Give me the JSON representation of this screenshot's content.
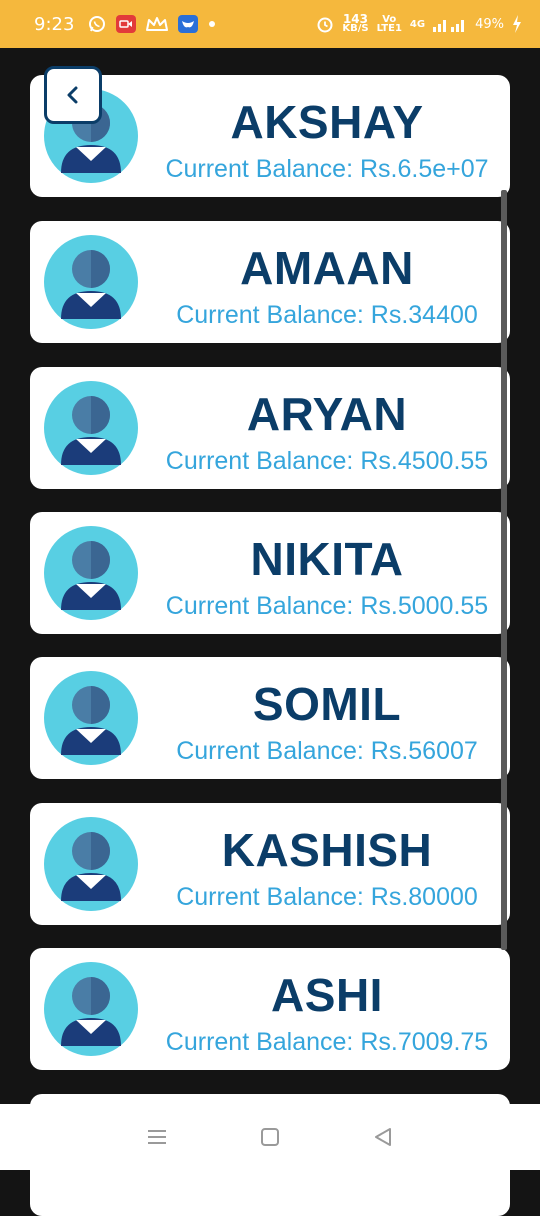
{
  "status_bar": {
    "time": "9:23",
    "net_speed_value": "143",
    "net_speed_unit": "KB/S",
    "volte_top": "Vo",
    "volte_bottom": "LTE1",
    "network_type": "4G",
    "battery": "49%",
    "icons": [
      "whatsapp-icon",
      "video-record-icon",
      "crown-icon",
      "bluesky-icon",
      "dot-icon",
      "alarm-icon",
      "signal-icon",
      "battery-charging-icon"
    ]
  },
  "customers": [
    {
      "name": "AKSHAY",
      "balance": "Current Balance: Rs.6.5e+07"
    },
    {
      "name": "AMAAN",
      "balance": "Current Balance: Rs.34400"
    },
    {
      "name": "ARYAN",
      "balance": "Current Balance: Rs.4500.55"
    },
    {
      "name": "NIKITA",
      "balance": "Current Balance: Rs.5000.55"
    },
    {
      "name": "SOMIL",
      "balance": "Current Balance: Rs.56007"
    },
    {
      "name": "KASHISH",
      "balance": "Current Balance: Rs.80000"
    },
    {
      "name": "ASHI",
      "balance": "Current Balance: Rs.7009.75"
    }
  ],
  "colors": {
    "status_bar": "#f5b83d",
    "background": "#141414",
    "name_text": "#0b3d68",
    "balance_text": "#35a5dc"
  },
  "nav_bar": {
    "icons": [
      "menu-icon",
      "home-square-icon",
      "back-triangle-icon"
    ]
  }
}
